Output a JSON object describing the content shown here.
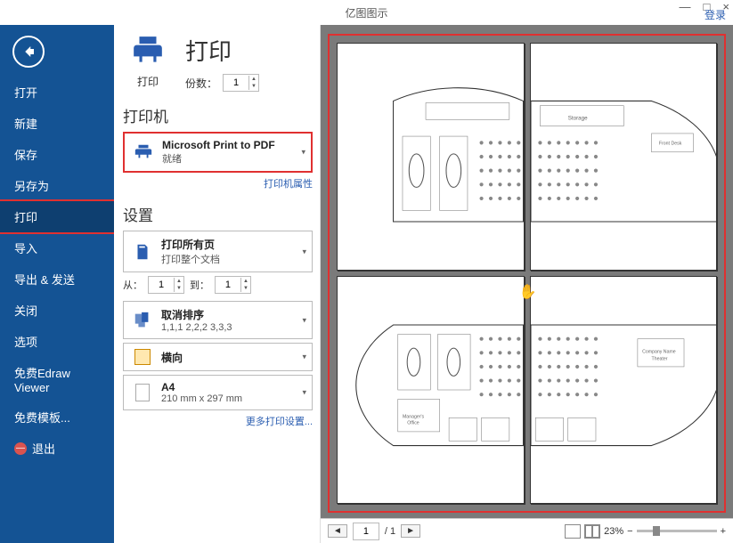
{
  "titlebar": {
    "app_name": "亿图图示",
    "login": "登录"
  },
  "sidebar": {
    "items": [
      {
        "label": "打开"
      },
      {
        "label": "新建"
      },
      {
        "label": "保存"
      },
      {
        "label": "另存为"
      },
      {
        "label": "打印",
        "selected": true
      },
      {
        "label": "导入"
      },
      {
        "label": "导出 & 发送"
      },
      {
        "label": "关闭"
      },
      {
        "label": "选项"
      },
      {
        "label": "免费Edraw Viewer"
      },
      {
        "label": "免费模板..."
      }
    ],
    "exit_label": "退出"
  },
  "print": {
    "icon_label": "打印",
    "title": "打印",
    "copies_label": "份数：",
    "copies_value": "1"
  },
  "printer": {
    "section_label": "打印机",
    "name": "Microsoft Print to PDF",
    "status": "就绪",
    "props_link": "打印机属性"
  },
  "settings": {
    "section_label": "设置",
    "scope_title": "打印所有页",
    "scope_sub": "打印整个文档",
    "from_label": "从：",
    "from_value": "1",
    "to_label": "到：",
    "to_value": "1",
    "collate_title": "取消排序",
    "collate_sub": "1,1,1  2,2,2  3,3,3",
    "orient_title": "横向",
    "paper_title": "A4",
    "paper_sub": "210 mm x 297 mm",
    "more_link": "更多打印设置..."
  },
  "footer": {
    "page_value": "1",
    "page_sep": "/ 1",
    "zoom_pct": "23%"
  }
}
